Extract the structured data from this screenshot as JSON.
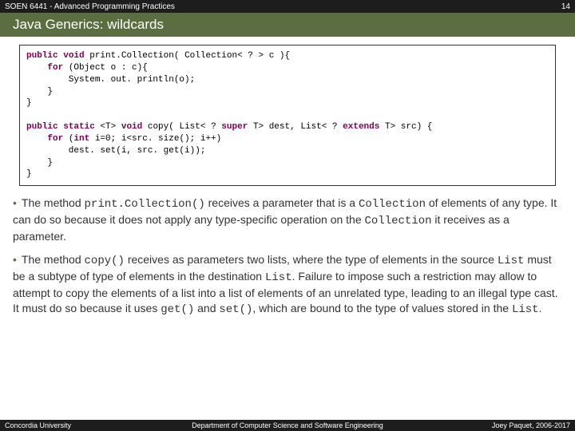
{
  "header": {
    "left": "SOEN 6441 - Advanced Programming Practices",
    "right": "14"
  },
  "title": "Java Generics: wildcards",
  "code": {
    "line1_kw1": "public",
    "line1_kw2": "void",
    "line1_name": "print.Collection(",
    "line1_type": "Collection< ? >",
    "line1_rest": " c ){",
    "line2_kw": "for",
    "line2_rest1": " (",
    "line2_obj": "Object",
    "line2_rest2": " o : c){",
    "line3": "        System. out. println(o);",
    "line4": "    }",
    "line5": "}",
    "blank": " ",
    "line6_kw1": "public",
    "line6_kw2": "static",
    "line6_gen": " <T> ",
    "line6_kw3": "void",
    "line6_name": " copy( ",
    "line6_t1": "List< ?",
    "line6_kw4": " super ",
    "line6_t1b": "T>",
    "line6_mid": " dest, ",
    "line6_t2": "List< ?",
    "line6_kw5": " extends ",
    "line6_t2b": "T>",
    "line6_end": " src) {",
    "line7_kw": "for",
    "line7_rest": " (",
    "line7_kw2": "int",
    "line7_rest2": " i=0; i<src. size(); i++)",
    "line8": "        dest. set(i, src. get(i));",
    "line9": "    }",
    "line10": "}"
  },
  "bullets": {
    "b1_part1": "The method ",
    "b1_code1": "print.Collection()",
    "b1_part2": " receives a parameter that is a ",
    "b1_code2": "Collection",
    "b1_part3": " of elements of any type. It can do so because it does not apply any type-specific operation on the ",
    "b1_code3": "Collection",
    "b1_part4": " it receives as a parameter.",
    "b2_part1": "The method ",
    "b2_code1": "copy()",
    "b2_part2": " receives as parameters two lists, where the type of elements in the source ",
    "b2_code2": "List",
    "b2_part3": " must be a subtype of type of elements in the destination ",
    "b2_code3": "List",
    "b2_part4": ". Failure to impose such a restriction may allow to attempt to copy the elements of a list into a list of elements of an unrelated type, leading to an illegal type cast. It must do so because it uses ",
    "b2_code4": "get()",
    "b2_part5": " and ",
    "b2_code5": "set()",
    "b2_part6": ", which are bound to the type of values stored in the ",
    "b2_code6": "List",
    "b2_part7": "."
  },
  "footer": {
    "left": "Concordia University",
    "center": "Department of Computer Science and Software Engineering",
    "right": "Joey Paquet, 2006-2017"
  }
}
